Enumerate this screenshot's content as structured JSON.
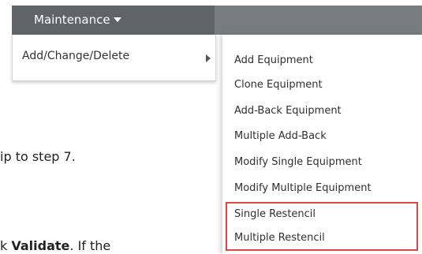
{
  "menubar": {
    "title": "Maintenance"
  },
  "dropdown": {
    "item": "Add/Change/Delete"
  },
  "submenu": {
    "items": [
      "Add Equipment",
      "Clone Equipment",
      "Add-Back Equipment",
      "Multiple Add-Back",
      "Modify Single Equipment",
      "Modify Multiple Equipment",
      "Single Restencil",
      "Multiple Restencil"
    ]
  },
  "document": {
    "line1": "ip to step 7.",
    "line2_prefix": "k ",
    "line2_bold": "Validate",
    "line2_suffix": ". If the"
  },
  "colors": {
    "menubar": "#5f6468",
    "menubar_right": "#767c80",
    "highlight": "#e04444"
  }
}
